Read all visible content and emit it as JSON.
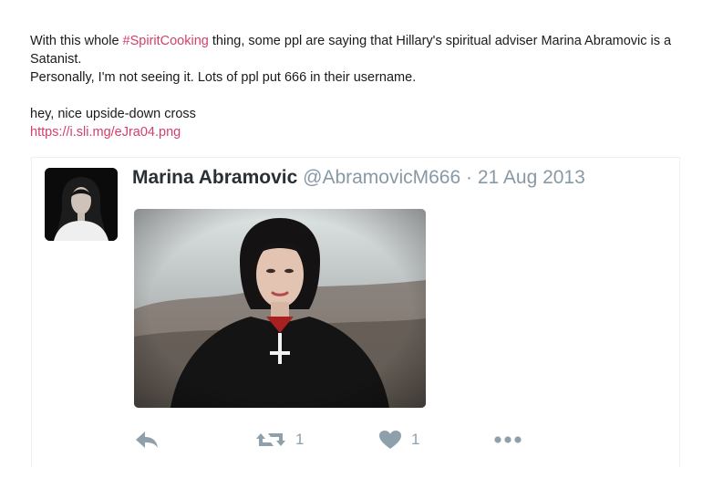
{
  "post": {
    "text_before_hashtag": "With this whole ",
    "hashtag": "#SpiritCooking",
    "text_after_hashtag": " thing, some ppl are saying that Hillary's spiritual adviser Marina Abramovic is a Satanist.",
    "line2": "Personally, I'm not seeing it. Lots of ppl put 666 in their username.",
    "line3": "hey, nice upside-down cross",
    "link": "https://i.sli.mg/eJra04.png"
  },
  "tweet": {
    "display_name": "Marina Abramovic",
    "handle": "@AbramovicM666",
    "separator": " · ",
    "date": "21 Aug 2013",
    "retweet_count": "1",
    "like_count": "1"
  },
  "icons": {
    "reply": "reply-arrow-icon",
    "retweet": "retweet-icon",
    "like": "heart-icon",
    "more": "more-dots-icon"
  },
  "colors": {
    "link": "#d43f6a",
    "muted": "#8899a6",
    "name": "#292f33"
  }
}
